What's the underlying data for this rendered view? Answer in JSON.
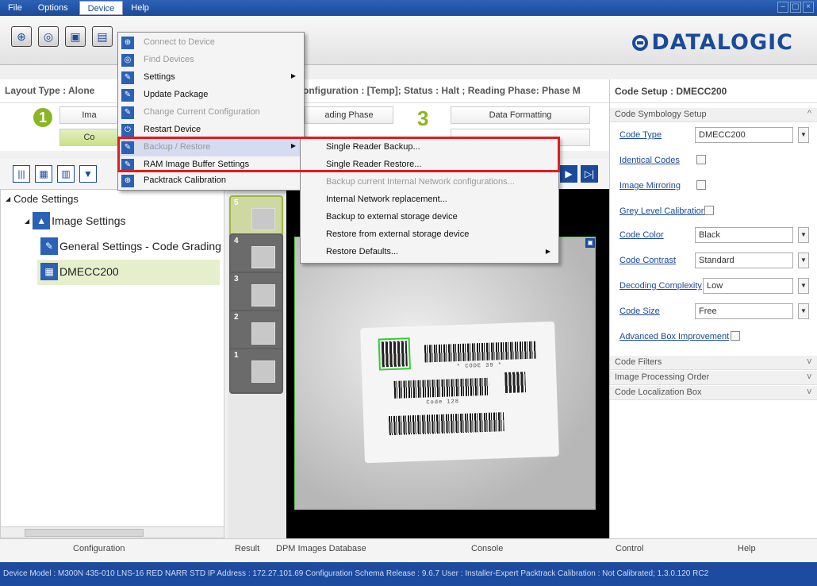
{
  "menubar": {
    "items": [
      "File",
      "Options",
      "Device",
      "Help"
    ]
  },
  "toolbar": {
    "logo": "DATALOGIC"
  },
  "infobar": {
    "layout_type": "Layout Type : Alone",
    "status": "onfiguration : [Temp];  Status : Halt ;  Reading Phase: Phase M"
  },
  "steps": {
    "num1": "1",
    "num3": "3",
    "btn_image": "Ima",
    "btn_code": "Co",
    "btn_reading_phase": "ading Phase",
    "btn_data_formatting": "Data Formatting"
  },
  "tree": {
    "root": "Code Settings",
    "image_settings": "Image Settings",
    "general_settings": "General Settings - Code Grading",
    "dmecc": "DMECC200"
  },
  "thumbs": [
    "5",
    "4",
    "3",
    "2",
    "1"
  ],
  "image": {
    "code_text_1": "* CODE 39 *",
    "code_text_2": "Code 128"
  },
  "bottom_tabs": {
    "configuration": "Configuration",
    "result": "Result",
    "dpm": "DPM Images Database",
    "console": "Console",
    "control": "Control",
    "help": "Help"
  },
  "right_panel": {
    "title": "Code Setup :  DMECC200",
    "section_symbology": "Code Symbology Setup",
    "code_type_label": "Code Type",
    "code_type_value": "DMECC200",
    "identical_codes": "Identical Codes",
    "image_mirroring": "Image Mirroring",
    "grey_level": "Grey Level Calibration",
    "code_color_label": "Code Color",
    "code_color_value": "Black",
    "code_contrast_label": "Code Contrast",
    "code_contrast_value": "Standard",
    "decoding_label": "Decoding Complexity",
    "decoding_value": "Low",
    "code_size_label": "Code Size",
    "code_size_value": "Free",
    "advanced_box": "Advanced Box Improvement",
    "section_filters": "Code Filters",
    "section_processing": "Image Processing Order",
    "section_localization": "Code Localization Box"
  },
  "device_menu": [
    {
      "label": "Connect to Device",
      "disabled": true
    },
    {
      "label": "Find Devices",
      "disabled": true
    },
    {
      "label": "Settings",
      "disabled": false
    },
    {
      "label": "Update Package",
      "disabled": false
    },
    {
      "label": "Change Current Configuration",
      "disabled": true
    },
    {
      "label": "Restart Device",
      "disabled": false
    },
    {
      "label": "Backup / Restore",
      "disabled": true
    },
    {
      "label": "RAM Image Buffer Settings",
      "disabled": false
    },
    {
      "label": "Packtrack Calibration",
      "disabled": false
    }
  ],
  "backup_submenu": [
    {
      "label": "Single Reader Backup...",
      "disabled": false
    },
    {
      "label": "Single Reader Restore...",
      "disabled": false
    },
    {
      "label": "Backup current Internal Network configurations...",
      "disabled": true
    },
    {
      "label": "Internal Network replacement...",
      "disabled": false
    },
    {
      "label": "Backup to external storage device",
      "disabled": false
    },
    {
      "label": "Restore from external storage device",
      "disabled": false
    },
    {
      "label": "Restore Defaults...",
      "disabled": false
    }
  ],
  "statusbar": "Device Model : M300N 435-010 LNS-16 RED NARR STD   IP Address : 172.27.101.69   Configuration Schema Release : 9.6.7   User : Installer-Expert   Packtrack Calibration : Not Calibrated; 1.3.0.120 RC2"
}
